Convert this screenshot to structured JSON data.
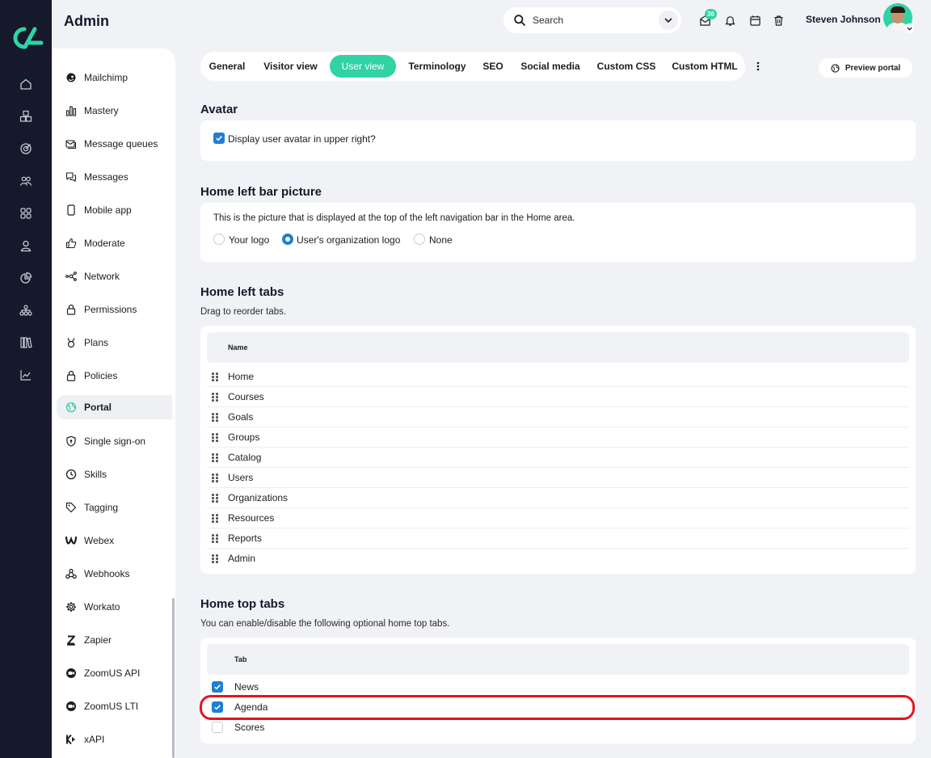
{
  "app": {
    "page_title": "Admin"
  },
  "header": {
    "search_placeholder": "Search",
    "inbox_badge": "36",
    "user_name": "Steven Johnson"
  },
  "rail": {
    "icons": [
      "home-icon",
      "cubes-icon",
      "target-icon",
      "people-icon",
      "grid-icon",
      "user-icon",
      "pie-chart-icon",
      "org-chart-icon",
      "library-icon",
      "line-chart-icon"
    ]
  },
  "menu": {
    "items": [
      {
        "label": "Mailchimp",
        "icon": "mailchimp-icon"
      },
      {
        "label": "Mastery",
        "icon": "bar-chart-icon"
      },
      {
        "label": "Message queues",
        "icon": "message-queue-icon"
      },
      {
        "label": "Messages",
        "icon": "chat-bubbles-icon"
      },
      {
        "label": "Mobile app",
        "icon": "mobile-icon"
      },
      {
        "label": "Moderate",
        "icon": "thumbs-up-icon"
      },
      {
        "label": "Network",
        "icon": "network-icon"
      },
      {
        "label": "Permissions",
        "icon": "lock-icon"
      },
      {
        "label": "Plans",
        "icon": "medal-icon"
      },
      {
        "label": "Policies",
        "icon": "lock-icon"
      },
      {
        "label": "Portal",
        "icon": "globe-icon",
        "active": true
      },
      {
        "label": "Single sign-on",
        "icon": "shield-icon"
      },
      {
        "label": "Skills",
        "icon": "clock-icon"
      },
      {
        "label": "Tagging",
        "icon": "tag-icon"
      },
      {
        "label": "Webex",
        "icon": "webex-icon"
      },
      {
        "label": "Webhooks",
        "icon": "webhooks-icon"
      },
      {
        "label": "Workato",
        "icon": "gear-icon"
      },
      {
        "label": "Zapier",
        "icon": "zapier-icon"
      },
      {
        "label": "ZoomUS API",
        "icon": "zoom-icon"
      },
      {
        "label": "ZoomUS LTI",
        "icon": "zoom-icon"
      },
      {
        "label": "xAPI",
        "icon": "xapi-icon"
      }
    ]
  },
  "tabs": {
    "items": [
      "General",
      "Visitor view",
      "User view",
      "Terminology",
      "SEO",
      "Social media",
      "Custom CSS",
      "Custom HTML"
    ],
    "active": "User view",
    "preview_label": "Preview portal"
  },
  "avatar_section": {
    "title": "Avatar",
    "checkbox_label": "Display user avatar in upper right?",
    "checked": true
  },
  "left_bar_picture": {
    "title": "Home left bar picture",
    "description": "This is the picture that is displayed at the top of the left navigation bar in the Home area.",
    "options": [
      "Your logo",
      "User's organization logo",
      "None"
    ],
    "selected": "User's organization logo"
  },
  "left_tabs": {
    "title": "Home left tabs",
    "subtitle": "Drag to reorder tabs.",
    "column_header": "Name",
    "rows": [
      "Home",
      "Courses",
      "Goals",
      "Groups",
      "Catalog",
      "Users",
      "Organizations",
      "Resources",
      "Reports",
      "Admin"
    ]
  },
  "top_tabs": {
    "title": "Home top tabs",
    "subtitle": "You can enable/disable the following optional home top tabs.",
    "column_header": "Tab",
    "rows": [
      {
        "label": "News",
        "checked": true
      },
      {
        "label": "Agenda",
        "checked": true
      },
      {
        "label": "Scores",
        "checked": false
      }
    ]
  },
  "colors": {
    "accent": "#2fd3a4",
    "checkbox": "#1f7fd1",
    "rail": "#16182b",
    "highlight": "#e8141b"
  }
}
